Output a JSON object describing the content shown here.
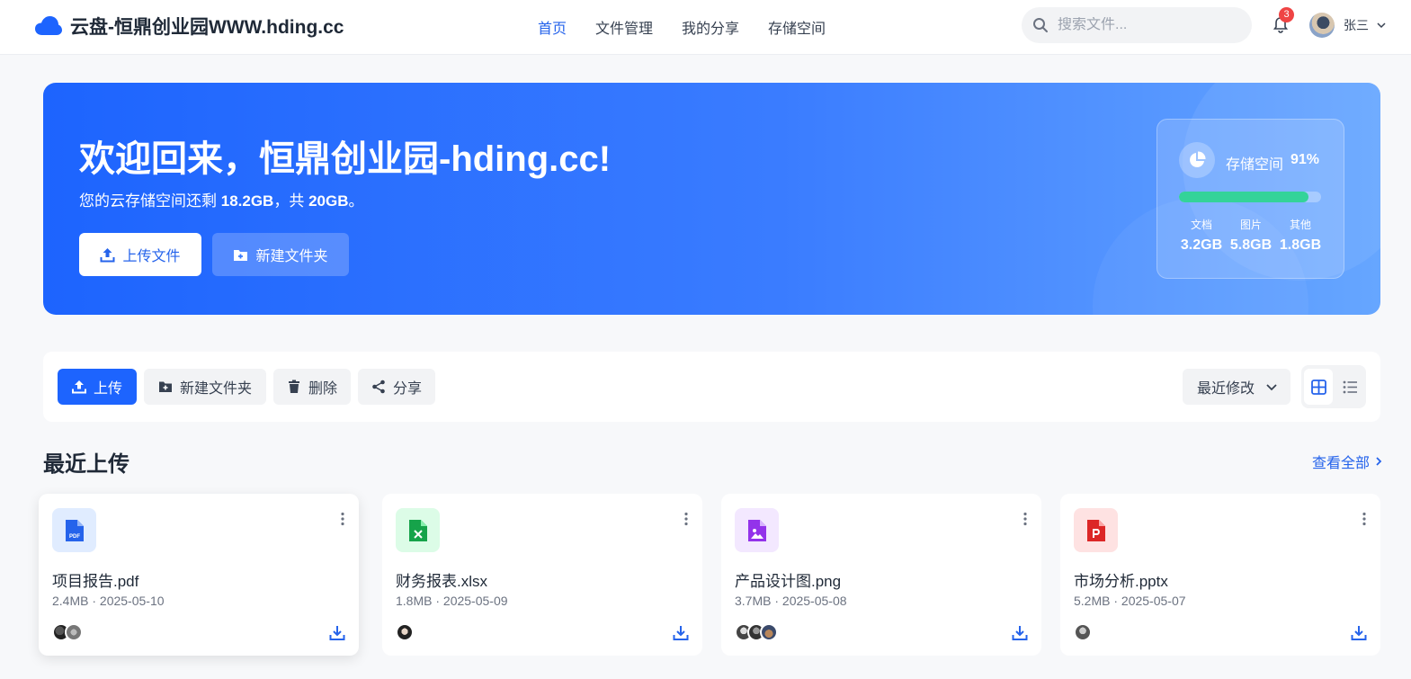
{
  "header": {
    "title": "云盘-恒鼎创业园WWW.hding.cc",
    "nav": [
      "首页",
      "文件管理",
      "我的分享",
      "存储空间"
    ],
    "search_placeholder": "搜索文件...",
    "notification_count": "3",
    "user_name": "张三"
  },
  "banner": {
    "heading": "欢迎回来，恒鼎创业园-hding.cc!",
    "sub_prefix": "您的云存储空间还剩 ",
    "remaining": "18.2GB",
    "sub_mid": "，共 ",
    "total": "20GB",
    "sub_suffix": "。",
    "upload_label": "上传文件",
    "new_folder_label": "新建文件夹",
    "storage": {
      "label": "存储空间",
      "percent": "91%",
      "usage_fraction": 0.91,
      "categories": [
        {
          "name": "文档",
          "value": "3.2GB"
        },
        {
          "name": "图片",
          "value": "5.8GB"
        },
        {
          "name": "其他",
          "value": "1.8GB"
        }
      ],
      "bar_color": "#34d399"
    }
  },
  "toolbar": {
    "upload": "上传",
    "new_folder": "新建文件夹",
    "delete": "删除",
    "share": "分享",
    "sort": "最近修改"
  },
  "recent": {
    "title": "最近上传",
    "view_all": "查看全部",
    "files": [
      {
        "name": "项目报告.pdf",
        "meta": "2.4MB · 2025-05-10",
        "icon": "pdf-icon",
        "color": "#2563eb",
        "bg": "#e0ecff"
      },
      {
        "name": "财务报表.xlsx",
        "meta": "1.8MB · 2025-05-09",
        "icon": "xlsx-icon",
        "color": "#16a34a",
        "bg": "#dcfce7"
      },
      {
        "name": "产品设计图.png",
        "meta": "3.7MB · 2025-05-08",
        "icon": "image-icon",
        "color": "#9333ea",
        "bg": "#f3e8ff"
      },
      {
        "name": "市场分析.pptx",
        "meta": "5.2MB · 2025-05-07",
        "icon": "pptx-icon",
        "color": "#dc2626",
        "bg": "#fee2e2"
      }
    ]
  },
  "colors": {
    "accent": "#1d64fe",
    "link": "#2563eb"
  }
}
